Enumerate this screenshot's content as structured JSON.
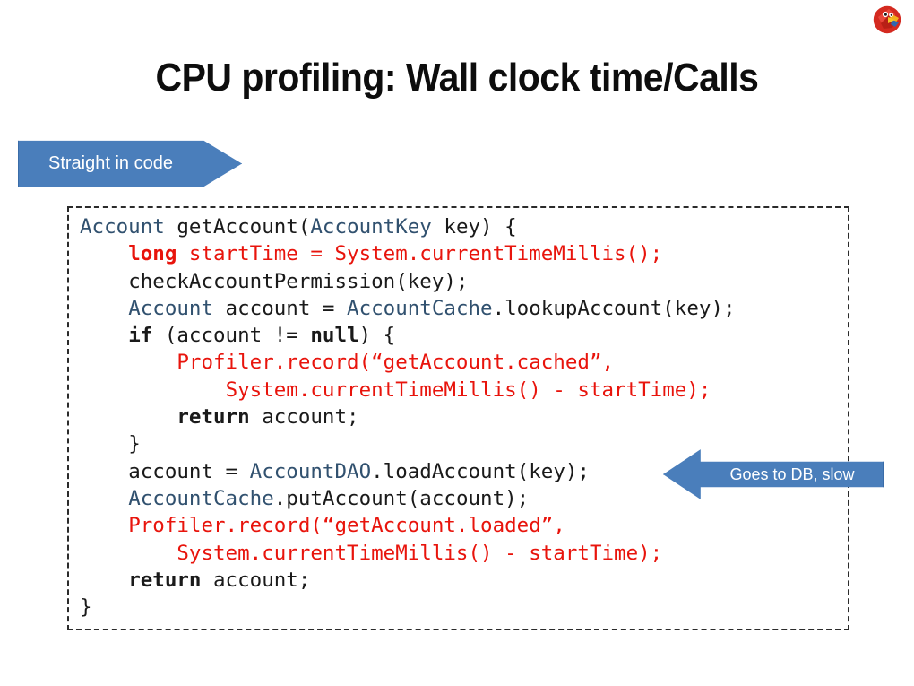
{
  "slide": {
    "title": "CPU profiling: Wall clock time/Calls",
    "logo_name": "red-parrot-logo"
  },
  "callouts": {
    "straight_in_code": {
      "label": "Straight in code",
      "direction": "right",
      "fill": "#4a7ebb",
      "stroke": "#3a6ca8",
      "text_color": "#ffffff"
    },
    "goes_to_db": {
      "label": "Goes to DB, slow",
      "direction": "left",
      "fill": "#4a7ebb",
      "stroke": "#3a6ca8",
      "text_color": "#ffffff"
    }
  },
  "code_block": {
    "language": "java",
    "border_style": "dashed",
    "colors": {
      "type": "#31516f",
      "keyword": "#1a1a1a",
      "highlight": "#e8140c",
      "plain": "#1a1a1a"
    },
    "plain_text": "Account getAccount(AccountKey key) {\n    long startTime = System.currentTimeMillis();\n    checkAccountPermission(key);\n    Account account = AccountCache.lookupAccount(key);\n    if (account != null) {\n        Profiler.record(“getAccount.cached”,\n            System.currentTimeMillis() - startTime);\n        return account;\n    }\n    account = AccountDAO.loadAccount(key);\n    AccountCache.putAccount(account);\n    Profiler.record(“getAccount.loaded”,\n        System.currentTimeMillis() - startTime);\n    return account;\n}",
    "lines": [
      {
        "indent": 0,
        "tokens": [
          {
            "t": "Account",
            "c": "type"
          },
          {
            "t": " getAccount(",
            "c": "plain"
          },
          {
            "t": "AccountKey",
            "c": "type"
          },
          {
            "t": " key) {",
            "c": "plain"
          }
        ]
      },
      {
        "indent": 4,
        "tokens": [
          {
            "t": "long",
            "c": "kw-red"
          },
          {
            "t": " startTime = System.currentTimeMillis();",
            "c": "red"
          }
        ]
      },
      {
        "indent": 4,
        "tokens": [
          {
            "t": "checkAccountPermission(key);",
            "c": "plain"
          }
        ]
      },
      {
        "indent": 4,
        "tokens": [
          {
            "t": "Account",
            "c": "type"
          },
          {
            "t": " account = ",
            "c": "plain"
          },
          {
            "t": "AccountCache",
            "c": "type"
          },
          {
            "t": ".lookupAccount(key);",
            "c": "plain"
          }
        ]
      },
      {
        "indent": 4,
        "tokens": [
          {
            "t": "if",
            "c": "kw"
          },
          {
            "t": " (account != ",
            "c": "plain"
          },
          {
            "t": "null",
            "c": "kw"
          },
          {
            "t": ") {",
            "c": "plain"
          }
        ]
      },
      {
        "indent": 8,
        "tokens": [
          {
            "t": "Profiler.record(“getAccount.cached”,",
            "c": "red"
          }
        ]
      },
      {
        "indent": 12,
        "tokens": [
          {
            "t": "System.currentTimeMillis() - startTime);",
            "c": "red"
          }
        ]
      },
      {
        "indent": 8,
        "tokens": [
          {
            "t": "return",
            "c": "kw"
          },
          {
            "t": " account;",
            "c": "plain"
          }
        ]
      },
      {
        "indent": 4,
        "tokens": [
          {
            "t": "}",
            "c": "plain"
          }
        ]
      },
      {
        "indent": 4,
        "tokens": [
          {
            "t": "account = ",
            "c": "plain"
          },
          {
            "t": "AccountDAO",
            "c": "type"
          },
          {
            "t": ".loadAccount(key);",
            "c": "plain"
          }
        ]
      },
      {
        "indent": 4,
        "tokens": [
          {
            "t": "AccountCache",
            "c": "type"
          },
          {
            "t": ".putAccount(account);",
            "c": "plain"
          }
        ]
      },
      {
        "indent": 4,
        "tokens": [
          {
            "t": "Profiler.record(“getAccount.loaded”,",
            "c": "red"
          }
        ]
      },
      {
        "indent": 8,
        "tokens": [
          {
            "t": "System.currentTimeMillis() - startTime);",
            "c": "red"
          }
        ]
      },
      {
        "indent": 4,
        "tokens": [
          {
            "t": "return",
            "c": "kw"
          },
          {
            "t": " account;",
            "c": "plain"
          }
        ]
      },
      {
        "indent": 0,
        "tokens": [
          {
            "t": "}",
            "c": "plain"
          }
        ]
      }
    ]
  }
}
